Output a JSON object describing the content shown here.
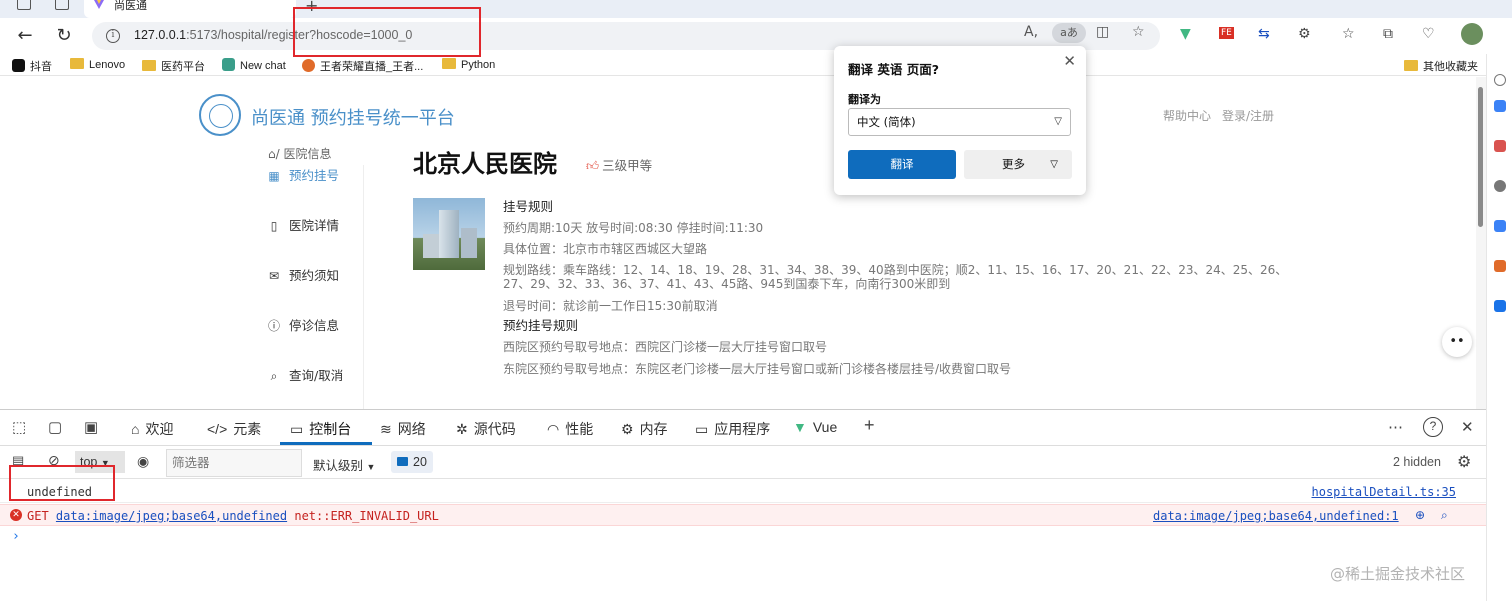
{
  "browser": {
    "tab_title": "尚医通",
    "url_host": "127.0.0.1",
    "url_rest": ":5173/hospital/register?hoscode=1000_0",
    "bookmarks": [
      "抖音",
      "Lenovo",
      "医药平台",
      "New chat",
      "王者荣耀直播_王者...",
      "Python"
    ],
    "other_bookmarks": "其他收藏夹"
  },
  "translate_popup": {
    "title": "翻译 英语 页面?",
    "translate_to_label": "翻译为",
    "selected_language": "中文 (简体)",
    "translate_button": "翻译",
    "more_button": "更多"
  },
  "site": {
    "brand": "尚医通 预约挂号统一平台",
    "help": "帮助中心",
    "login": "登录/注册"
  },
  "sidebar": {
    "breadcrumb": "/ 医院信息",
    "items": [
      {
        "label": "预约挂号",
        "icon": "grid-icon"
      },
      {
        "label": "医院详情",
        "icon": "document-icon"
      },
      {
        "label": "预约须知",
        "icon": "mail-icon"
      },
      {
        "label": "停诊信息",
        "icon": "info-icon"
      },
      {
        "label": "查询/取消",
        "icon": "search-icon"
      }
    ]
  },
  "hospital": {
    "name": "北京人民医院",
    "level": "三级甲等",
    "rules_title": "挂号规则",
    "cycle": "预约周期:10天 放号时间:08:30 停挂时间:11:30",
    "address": "具体位置：北京市市辖区西城区大望路",
    "route": "规划路线：乘车路线：12、14、18、19、28、31、34、38、39、40路到中医院；顺2、11、15、16、17、20、21、22、23、24、25、26、27、29、32、33、36、37、41、43、45路、945到国泰下车，向南行300米即到",
    "quit_time": "退号时间：就诊前一工作日15:30前取消",
    "booking_rules_title": "预约挂号规则",
    "rules": [
      "西院区预约号取号地点：西院区门诊楼一层大厅挂号窗口取号",
      "东院区预约号取号地点：东院区老门诊楼一层大厅挂号窗口或新门诊楼各楼层挂号/收费窗口取号"
    ]
  },
  "devtools": {
    "tabs": [
      {
        "label": "欢迎",
        "icon": "home-icon"
      },
      {
        "label": "元素",
        "icon": "code-icon"
      },
      {
        "label": "控制台",
        "icon": "console-icon"
      },
      {
        "label": "网络",
        "icon": "wifi-icon"
      },
      {
        "label": "源代码",
        "icon": "bug-icon"
      },
      {
        "label": "性能",
        "icon": "gauge-icon"
      },
      {
        "label": "内存",
        "icon": "chip-icon"
      },
      {
        "label": "应用程序",
        "icon": "app-icon"
      },
      {
        "label": "Vue",
        "icon": "vue-icon"
      }
    ],
    "active_tab": "控制台",
    "context": "top",
    "filter_placeholder": "筛选器",
    "level": "默认级别",
    "issues_count": "20",
    "hidden": "2 hidden",
    "console": {
      "log_message": "undefined",
      "log_source": "hospitalDetail.ts:35",
      "error_method": "GET",
      "error_url": "data:image/jpeg;base64,undefined",
      "error_code": "net::ERR_INVALID_URL",
      "error_source": "data:image/jpeg;base64,undefined:1"
    }
  },
  "watermark": "@稀土掘金技术社区",
  "colors": {
    "brand": "#4a90c9",
    "accent": "#0f6cbd",
    "error": "#d93025",
    "annotation": "#e0272c"
  }
}
